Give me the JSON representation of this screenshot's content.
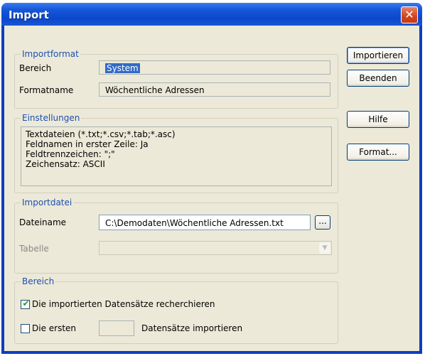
{
  "window": {
    "title": "Import",
    "close_glyph": "✕"
  },
  "importformat": {
    "legend": "Importformat",
    "bereich_label": "Bereich",
    "bereich_value": "System",
    "formatname_label": "Formatname",
    "formatname_value": "Wöchentliche Adressen"
  },
  "einstellungen": {
    "legend": "Einstellungen",
    "lines": [
      "Textdateien (*.txt;*.csv;*.tab;*.asc)",
      "Feldnamen in erster Zeile: Ja",
      "Feldtrennzeichen: \";\"",
      "Zeichensatz: ASCII"
    ]
  },
  "importdatei": {
    "legend": "Importdatei",
    "dateiname_label": "Dateiname",
    "dateiname_value": "C:\\Demodaten\\Wöchentliche Adressen.txt",
    "browse_label": "...",
    "tabelle_label": "Tabelle",
    "tabelle_value": ""
  },
  "bereich": {
    "legend": "Bereich",
    "recherchieren_label": "Die importierten Datensätze recherchieren",
    "recherchieren_checked": true,
    "check_glyph": "✔",
    "ersten_prefix": "Die ersten",
    "ersten_suffix": "Datensätze importieren",
    "ersten_checked": false,
    "ersten_value": ""
  },
  "buttons": {
    "importieren": "Importieren",
    "beenden": "Beenden",
    "hilfe": "Hilfe",
    "format": "Format..."
  },
  "colors": {
    "titlebar": "#0a47cc",
    "dialog_bg": "#ece9d8",
    "legend": "#1c4fb0",
    "selection": "#316ac5"
  }
}
